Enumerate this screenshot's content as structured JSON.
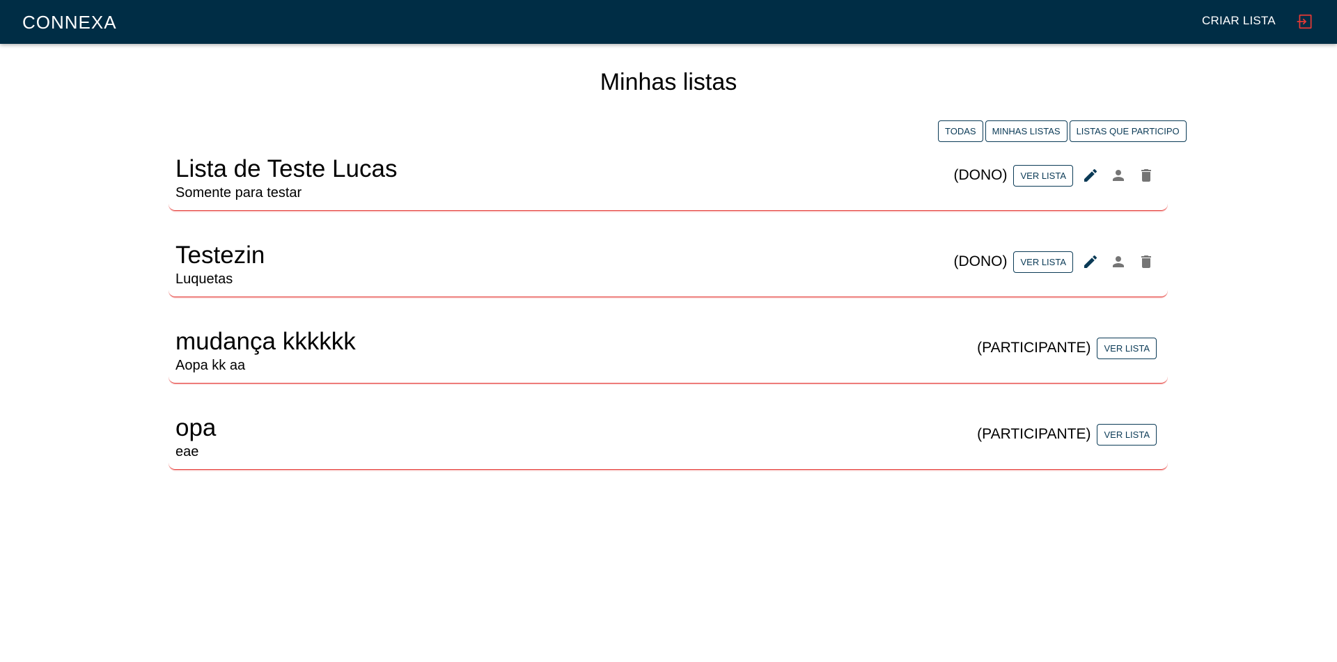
{
  "app": {
    "logo_text": "CONNEXA",
    "create_list_label": "CRIAR LISTA",
    "logout_icon": "logout-icon"
  },
  "page": {
    "title": "Minhas listas"
  },
  "filters": [
    {
      "label": "TODAS"
    },
    {
      "label": "MINHAS LISTAS"
    },
    {
      "label": "LISTAS QUE PARTICIPO"
    }
  ],
  "lists": [
    {
      "title": "Lista de Teste Lucas",
      "subtitle": "Somente para testar",
      "role": "(DONO)",
      "view_label": "VER LISTA",
      "owner": true
    },
    {
      "title": "Testezin",
      "subtitle": "Luquetas",
      "role": "(DONO)",
      "view_label": "VER LISTA",
      "owner": true
    },
    {
      "title": "mudança kkkkkk",
      "subtitle": "Aopa kk aa",
      "role": "(PARTICIPANTE)",
      "view_label": "VER LISTA",
      "owner": false
    },
    {
      "title": "opa",
      "subtitle": "eae",
      "role": "(PARTICIPANTE)",
      "view_label": "VER LISTA",
      "owner": false
    }
  ],
  "colors": {
    "header_bg": "#002d45",
    "accent_red": "#e53935",
    "button_border": "#0a3a56",
    "edit_icon": "#0a3a56",
    "muted_icon": "#757575"
  }
}
